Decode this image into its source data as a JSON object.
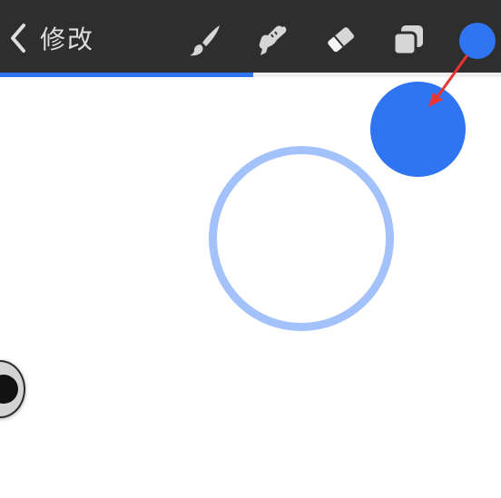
{
  "toolbar": {
    "back_label": "修改",
    "tools": {
      "brush": "brush-icon",
      "smudge": "smudge-icon",
      "eraser": "eraser-icon",
      "layers": "layers-icon"
    },
    "active_color": "#2f74f0"
  },
  "colors": {
    "toolbar_bg": "#2e2e2e",
    "accent": "#2f74f0",
    "ring": "#a3c2fb",
    "annotation_arrow": "#ee3333"
  },
  "progress": {
    "fraction": 0.505
  },
  "canvas": {
    "elements": [
      "filled-color-dot",
      "selection-ring"
    ]
  }
}
